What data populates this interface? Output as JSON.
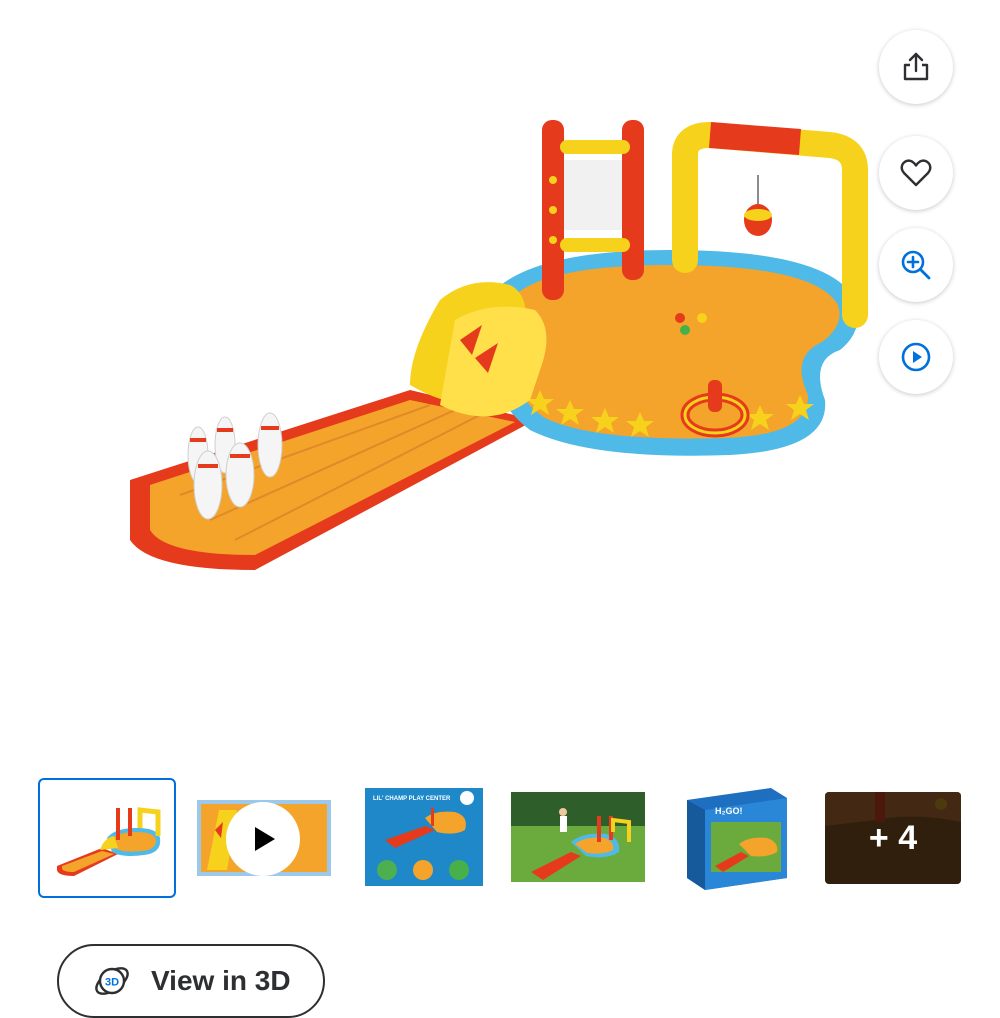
{
  "product": {
    "image_alt": "inflatable bowling play center pool with slide"
  },
  "actions": [
    {
      "name": "share-button",
      "icon": "share-icon"
    },
    {
      "name": "favorite-button",
      "icon": "heart-icon"
    },
    {
      "name": "zoom-button",
      "icon": "zoom-in-icon"
    },
    {
      "name": "video-button",
      "icon": "play-circle-icon"
    }
  ],
  "thumbnails": {
    "box_brand": "H₂GO!",
    "infographic_title": "LIL' CHAMP PLAY CENTER",
    "more_count": "+ 4"
  },
  "view_3d": {
    "label": "View in 3D",
    "badge": "3D"
  },
  "colors": {
    "accent": "#0071dc",
    "text": "#2e2f32"
  }
}
